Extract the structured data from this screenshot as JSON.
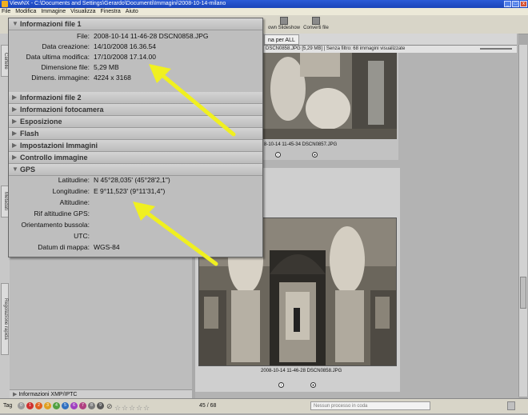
{
  "window": {
    "title": "ViewNX - C:\\Documents and Settings\\Gerardo\\Documenti\\Immagini\\2008-10-14-milano",
    "controls": [
      "_",
      "□",
      "x"
    ]
  },
  "menu": [
    "File",
    "Modifica",
    "Immagine",
    "Visualizza",
    "Finestra",
    "Aiuto"
  ],
  "toolbar": {
    "slideshow_label": "own  Slideshow",
    "convert_label": "Converti file"
  },
  "left_tabs": [
    "Cartelle",
    "Metadati",
    "Regolazione rapida"
  ],
  "browser": {
    "tab_label": "na per ALL",
    "status_text": "DSCN0858.JPG [5,29 MB] | Senza filtro: 68 immagini visualizzate"
  },
  "thumbnails": [
    {
      "caption": "8-10-14 11-45-34 DSCN0857.JPG"
    },
    {
      "caption": "2008-10-14 11-46-28 DSCN0858.JPG"
    }
  ],
  "info_panel": {
    "section_file1": {
      "title": "Informazioni file 1",
      "rows": [
        {
          "key": "File:",
          "value": "2008-10-14 11-46-28 DSCN0858.JPG"
        },
        {
          "key": "Data creazione:",
          "value": "14/10/2008 16.36.54"
        },
        {
          "key": "Data ultima modifica:",
          "value": "17/10/2008 17.14.00"
        },
        {
          "key": "Dimensione file:",
          "value": "5,29 MB"
        },
        {
          "key": "Dimens. immagine:",
          "value": "4224 x 3168"
        }
      ]
    },
    "collapsed_sections": [
      "Informazioni file 2",
      "Informazioni fotocamera",
      "Esposizione",
      "Flash",
      "Impostazioni Immagini",
      "Controllo immagine"
    ],
    "section_gps": {
      "title": "GPS",
      "rows": [
        {
          "key": "Latitudine:",
          "value": "N 45°28,035' (45°28'2,1\")"
        },
        {
          "key": "Longitudine:",
          "value": "E 9°11,523' (9°11'31,4\")"
        },
        {
          "key": "Altitudine:",
          "value": ""
        },
        {
          "key": "Rif altitudine GPS:",
          "value": ""
        },
        {
          "key": "Orientamento bussola:",
          "value": ""
        },
        {
          "key": "UTC:",
          "value": ""
        },
        {
          "key": "Datum di mappa:",
          "value": "WGS-84"
        }
      ]
    }
  },
  "xmp_label": "Informazioni XMP/IPTC",
  "bottom_bar": {
    "tag_label": "Tag",
    "labels": [
      "0",
      "1",
      "2",
      "3",
      "4",
      "5",
      "6",
      "7",
      "8",
      "9"
    ],
    "label_colors": [
      "#9a9a9a",
      "#d03030",
      "#e06020",
      "#e0a020",
      "#50a040",
      "#3070c0",
      "#a040c0",
      "#b04080",
      "#7a7a7a",
      "#5a5a5a"
    ],
    "page_counter": "45 / 68",
    "process_placeholder": "Nessun processo in coda"
  },
  "annotation": {
    "arrow_color": "#f0f020"
  }
}
